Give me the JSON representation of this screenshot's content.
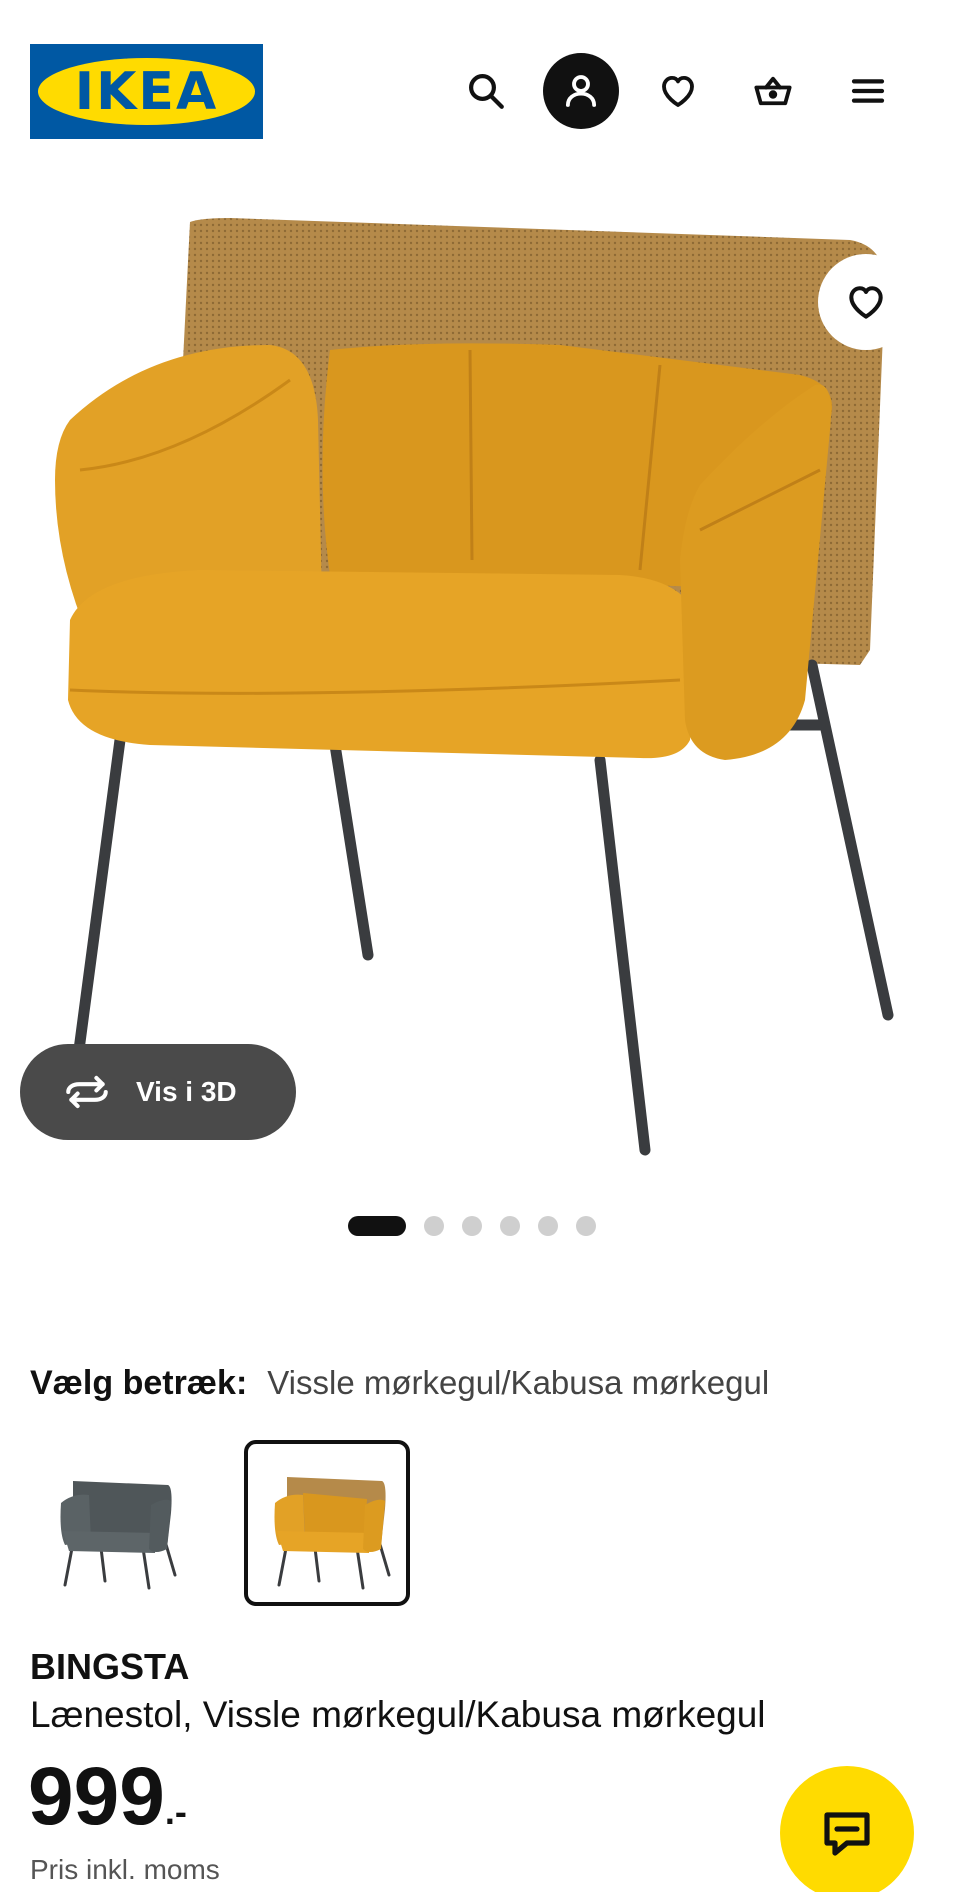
{
  "header": {
    "logo_text": "IKEA",
    "icons": [
      "search-icon",
      "profile-icon",
      "heart-icon",
      "basket-icon",
      "menu-icon"
    ]
  },
  "gallery": {
    "view3d_label": "Vis i 3D",
    "dots_total": 6,
    "dots_active": 1
  },
  "variant": {
    "label": "Vælg betræk:",
    "value": "Vissle mørkegul/Kabusa mørkegul",
    "options": [
      {
        "color_name": "dark grey",
        "selected": false
      },
      {
        "color_name": "dark yellow",
        "selected": true
      }
    ]
  },
  "product": {
    "name": "BINGSTA",
    "description": "Lænestol, Vissle mørkegul/Kabusa mørkegul",
    "price_integer": "999",
    "price_suffix": ".-",
    "price_note": "Pris inkl. moms"
  },
  "colors": {
    "ikea_blue": "#0058a3",
    "ikea_yellow": "#ffdb00",
    "chair_yellow": "#e0a020",
    "back_mesh": "#b58a4a"
  }
}
